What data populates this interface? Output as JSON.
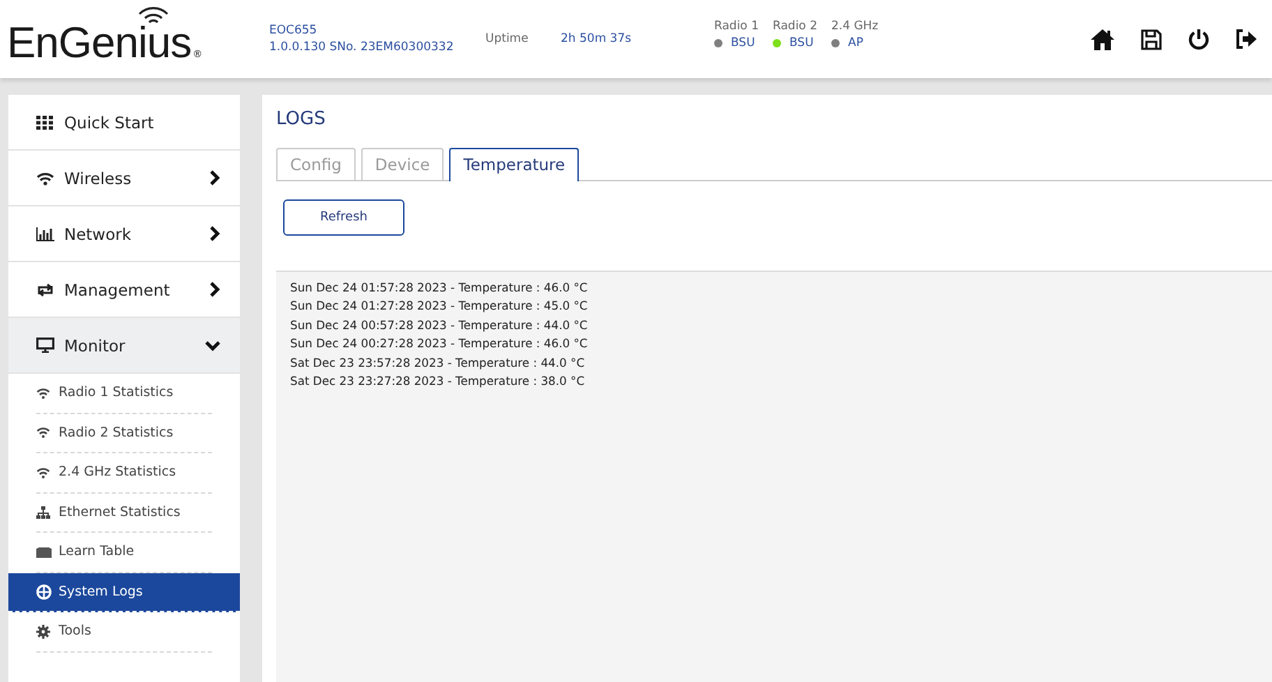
{
  "header": {
    "logo": "EnGenius",
    "logo_mark": "®",
    "model": "EOC655",
    "version": "1.0.0.130 SNo. 23EM60300332",
    "uptime_label": "Uptime",
    "uptime": "2h 50m 37s",
    "radios": [
      {
        "label": "Radio 1",
        "mode": "BSU",
        "color": "#808080"
      },
      {
        "label": "Radio 2",
        "mode": "BSU",
        "color": "#7ee01a"
      },
      {
        "label": "2.4 GHz",
        "mode": "AP",
        "color": "#808080"
      }
    ]
  },
  "sidebar": {
    "items": [
      {
        "label": "Quick Start"
      },
      {
        "label": "Wireless",
        "expanded": false
      },
      {
        "label": "Network",
        "expanded": false
      },
      {
        "label": "Management",
        "expanded": false
      },
      {
        "label": "Monitor",
        "expanded": true,
        "children": [
          {
            "label": "Radio 1 Statistics",
            "selected": false
          },
          {
            "label": "Radio 2 Statistics",
            "selected": false
          },
          {
            "label": "2.4 GHz Statistics",
            "selected": false
          },
          {
            "label": "Ethernet Statistics",
            "selected": false
          },
          {
            "label": "Learn Table",
            "selected": false
          },
          {
            "label": "System Logs",
            "selected": true
          },
          {
            "label": "Tools",
            "selected": false
          }
        ]
      }
    ]
  },
  "page": {
    "title": "LOGS",
    "tabs": [
      {
        "label": "Config",
        "selected": false
      },
      {
        "label": "Device",
        "selected": false
      },
      {
        "label": "Temperature",
        "selected": true
      }
    ],
    "button": "Refresh",
    "log_lines": [
      "Sun Dec 24 01:57:28 2023 - Temperature : 46.0 °C",
      "Sun Dec 24 01:27:28 2023 - Temperature : 45.0 °C",
      "Sun Dec 24 00:57:28 2023 - Temperature : 44.0 °C",
      "Sun Dec 24 00:27:28 2023 - Temperature : 46.0 °C",
      "Sat Dec 23 23:57:28 2023 - Temperature : 44.0 °C",
      "Sat Dec 23 23:27:28 2023 - Temperature : 38.0 °C"
    ]
  }
}
